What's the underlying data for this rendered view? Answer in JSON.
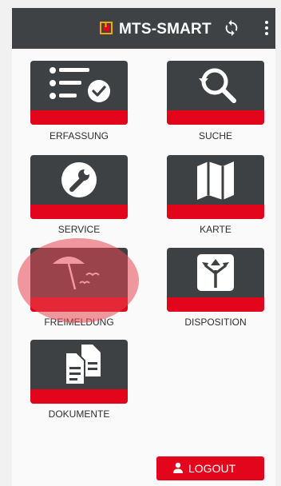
{
  "header": {
    "title": "MTS-SMART",
    "logo_icon": "app-logo-icon",
    "sync_icon": "sync-icon",
    "menu_icon": "more-vert-icon"
  },
  "tiles": [
    {
      "label": "ERFASSUNG",
      "icon": "checklist-icon"
    },
    {
      "label": "SUCHE",
      "icon": "search-history-icon"
    },
    {
      "label": "SERVICE",
      "icon": "wrench-icon"
    },
    {
      "label": "KARTE",
      "icon": "map-icon"
    },
    {
      "label": "FREIMELDUNG",
      "icon": "beach-umbrella-icon"
    },
    {
      "label": "DISPOSITION",
      "icon": "directions-icon"
    },
    {
      "label": "DOKUMENTE",
      "icon": "documents-icon"
    }
  ],
  "logout": {
    "label": "LOGOUT",
    "icon": "person-icon"
  },
  "colors": {
    "topbar": "#3e4245",
    "tile": "#3d4144",
    "accent": "#e3051b",
    "background": "#fafafa"
  }
}
